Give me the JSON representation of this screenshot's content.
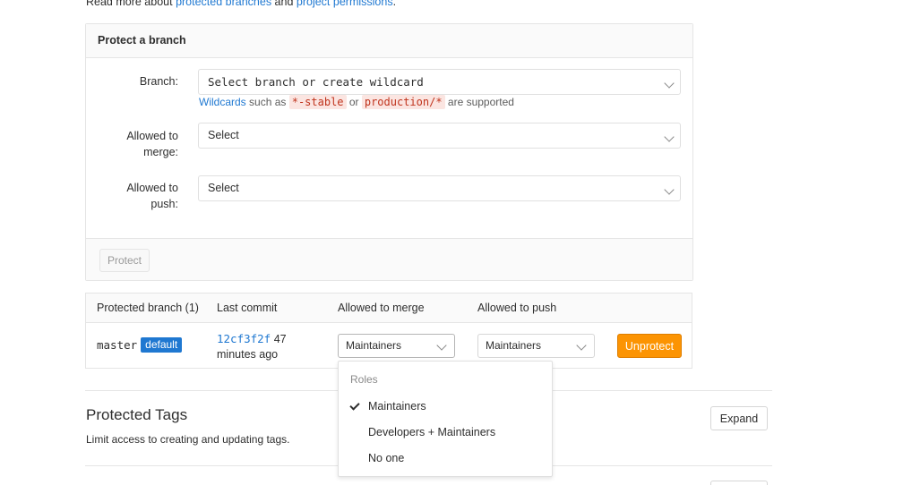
{
  "intro": {
    "prefix": "Read more about ",
    "link1": "protected branches",
    "middle": " and ",
    "link2": "project permissions",
    "suffix": "."
  },
  "protect_form": {
    "title": "Protect a branch",
    "branch_label": "Branch:",
    "branch_placeholder": "Select branch or create wildcard",
    "hint_link": "Wildcards",
    "hint_text1": " such as ",
    "hint_code1": "*-stable",
    "hint_text2": " or ",
    "hint_code2": "production/*",
    "hint_text3": " are supported",
    "merge_label_line1": "Allowed to",
    "merge_label_line2": "merge:",
    "merge_value": "Select",
    "push_label_line1": "Allowed to",
    "push_label_line2": "push:",
    "push_value": "Select",
    "protect_button": "Protect"
  },
  "branches_table": {
    "headers": [
      "Protected branch (1)",
      "Last commit",
      "Allowed to merge",
      "Allowed to push"
    ],
    "row": {
      "branch": "master",
      "badge": "default",
      "commit_sha": "12cf3f2f",
      "commit_time_part1": "47",
      "commit_time_part2": "minutes ago",
      "merge_value": "Maintainers",
      "push_value": "Maintainers",
      "unprotect_button": "Unprotect"
    }
  },
  "dropdown": {
    "header": "Roles",
    "items": [
      {
        "label": "Maintainers",
        "checked": true
      },
      {
        "label": "Developers + Maintainers",
        "checked": false
      },
      {
        "label": "No one",
        "checked": false
      }
    ]
  },
  "protected_tags": {
    "title": "Protected Tags",
    "description": "Limit access to creating and updating tags.",
    "expand_button": "Expand"
  },
  "colors": {
    "link": "#1f78d1",
    "badge": "#1f78d1",
    "unprotect": "#fc9403",
    "code": "#c0341d"
  }
}
